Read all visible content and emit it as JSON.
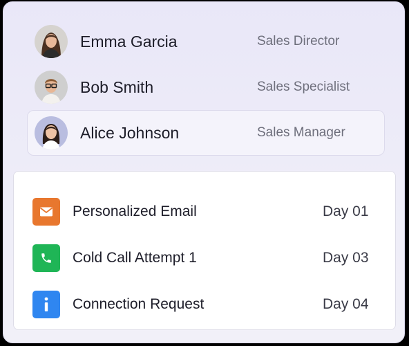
{
  "people": [
    {
      "name": "Emma Garcia",
      "role": "Sales Director",
      "selected": false
    },
    {
      "name": "Bob Smith",
      "role": "Sales Specialist",
      "selected": false
    },
    {
      "name": "Alice Johnson",
      "role": "Sales Manager",
      "selected": true
    }
  ],
  "steps": [
    {
      "label": "Personalized Email",
      "day": "Day 01",
      "icon": "envelope-icon",
      "color": "#e8772e"
    },
    {
      "label": "Cold Call Attempt 1",
      "day": "Day 03",
      "icon": "phone-icon",
      "color": "#1fb556"
    },
    {
      "label": "Connection Request",
      "day": "Day 04",
      "icon": "info-icon",
      "color": "#2f86f0"
    }
  ]
}
